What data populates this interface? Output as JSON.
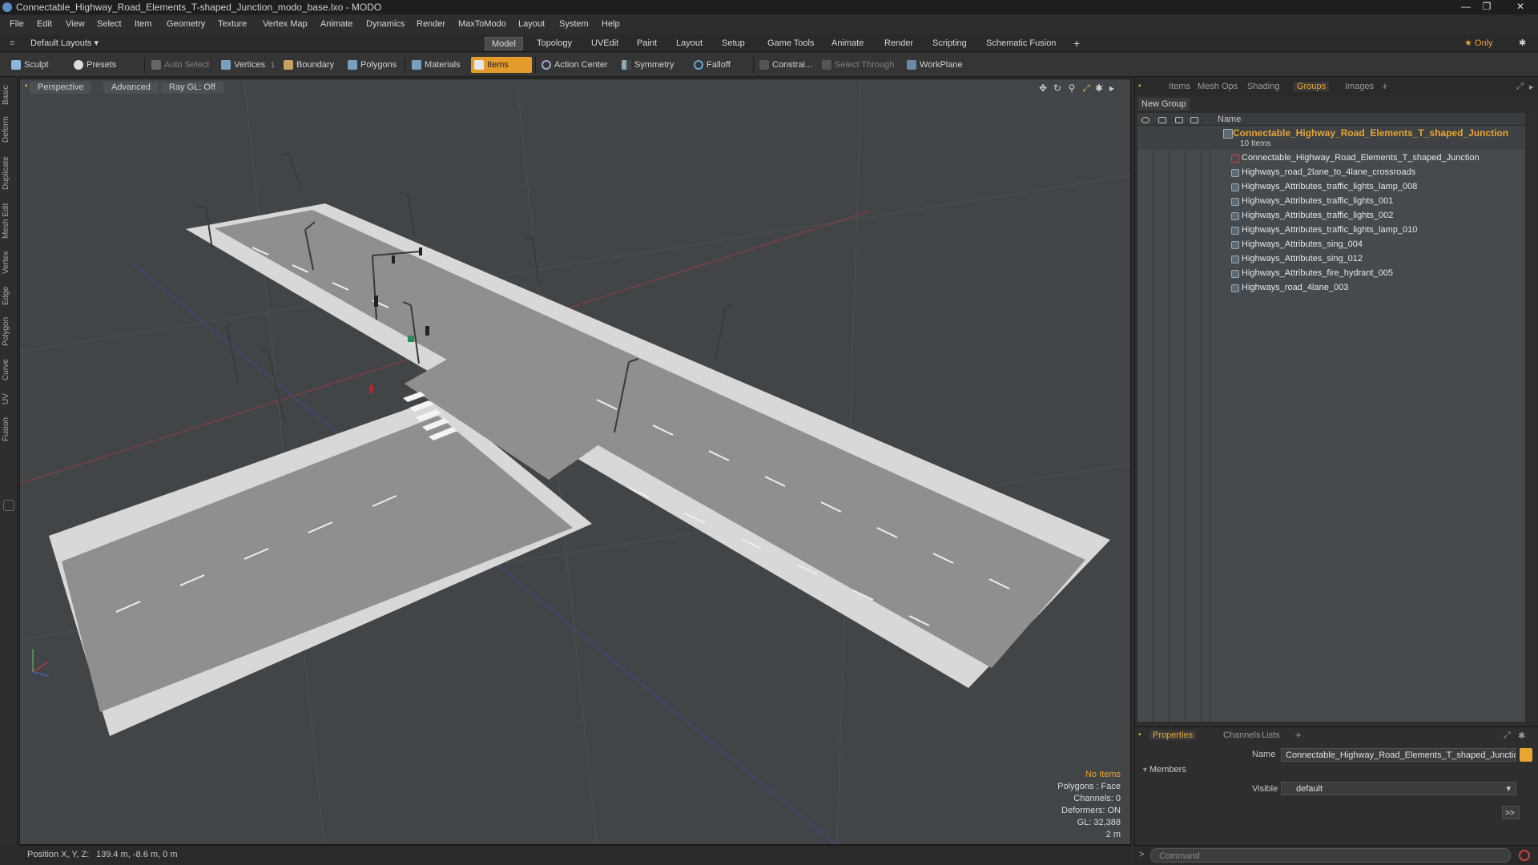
{
  "window": {
    "title": "Connectable_Highway_Road_Elements_T-shaped_Junction_modo_base.lxo - MODO",
    "minimize": "—",
    "maximize": "❐",
    "close": "✕"
  },
  "menu": [
    "File",
    "Edit",
    "View",
    "Select",
    "Item",
    "Geometry",
    "Texture",
    "Vertex Map",
    "Animate",
    "Dynamics",
    "Render",
    "MaxToModo",
    "Layout",
    "System",
    "Help"
  ],
  "layout_bar": {
    "layouts_label": "Default Layouts ▾",
    "tabs": [
      "Model",
      "Topology",
      "UVEdit",
      "Paint",
      "Layout",
      "Setup",
      "Game Tools",
      "Animate",
      "Render",
      "Scripting",
      "Schematic Fusion"
    ],
    "active_tab": "Model",
    "add": "+",
    "only_label": "★  Only",
    "settings": "✱"
  },
  "toolbar": {
    "sculpt": "Sculpt",
    "presets": "Presets",
    "auto_select": "Auto Select",
    "vertices": "Vertices",
    "vertices_count": "1",
    "boundary": "Boundary",
    "polygons": "Polygons",
    "materials": "Materials",
    "items": "Items",
    "action_center": "Action Center",
    "symmetry": "Symmetry",
    "falloff": "Falloff",
    "constrain": "Constrai...",
    "select_through": "Select Through",
    "workplane": "WorkPlane"
  },
  "left_tabs": [
    "Basic",
    "Deform",
    "Duplicate",
    "Mesh Edit",
    "Vertex",
    "Edge",
    "Polygon",
    "Curve",
    "UV",
    "Fusion"
  ],
  "viewport": {
    "view_mode": "Perspective",
    "shading": "Advanced",
    "raygl": "Ray GL: Off",
    "info": {
      "no_items": "No Items",
      "polygons": "Polygons : Face",
      "channels": "Channels: 0",
      "deformers": "Deformers: ON",
      "gl": "GL: 32,388",
      "scale": "2 m"
    }
  },
  "status": {
    "position_label": "Position X, Y, Z:",
    "position_value": "139.4 m, -8.6 m, 0 m"
  },
  "right_panel": {
    "tabs": [
      "Items",
      "Mesh Ops",
      "Shading",
      "Groups",
      "Images"
    ],
    "active_tab": "Groups",
    "add": "+",
    "new_group": "New Group",
    "name_header": "Name",
    "group": {
      "name": "Connectable_Highway_Road_Elements_T_shaped_Junction",
      "count": "10 Items"
    },
    "items": [
      "Connectable_Highway_Road_Elements_T_shaped_Junction",
      "Highways_road_2lane_to_4lane_crossroads",
      "Highways_Attributes_traffic_lights_lamp_008",
      "Highways_Attributes_traffic_lights_001",
      "Highways_Attributes_traffic_lights_002",
      "Highways_Attributes_traffic_lights_lamp_010",
      "Highways_Attributes_sing_004",
      "Highways_Attributes_sing_012",
      "Highways_Attributes_fire_hydrant_005",
      "Highways_road_4lane_003"
    ]
  },
  "properties": {
    "tabs": [
      "Properties",
      "Channels",
      "Lists"
    ],
    "active_tab": "Properties",
    "add": "+",
    "name_label": "Name",
    "name_value": "Connectable_Highway_Road_Elements_T_shaped_Junctio",
    "members_label": "Members",
    "visible_label": "Visible",
    "visible_value": "default",
    "more": ">>"
  },
  "command": {
    "placeholder": "Command",
    "prompt": ">"
  },
  "colors": {
    "accent": "#e8a531",
    "viewport_bg": "#414548",
    "road": "#8a8a8a",
    "sidewalk": "#d9d9d9"
  }
}
